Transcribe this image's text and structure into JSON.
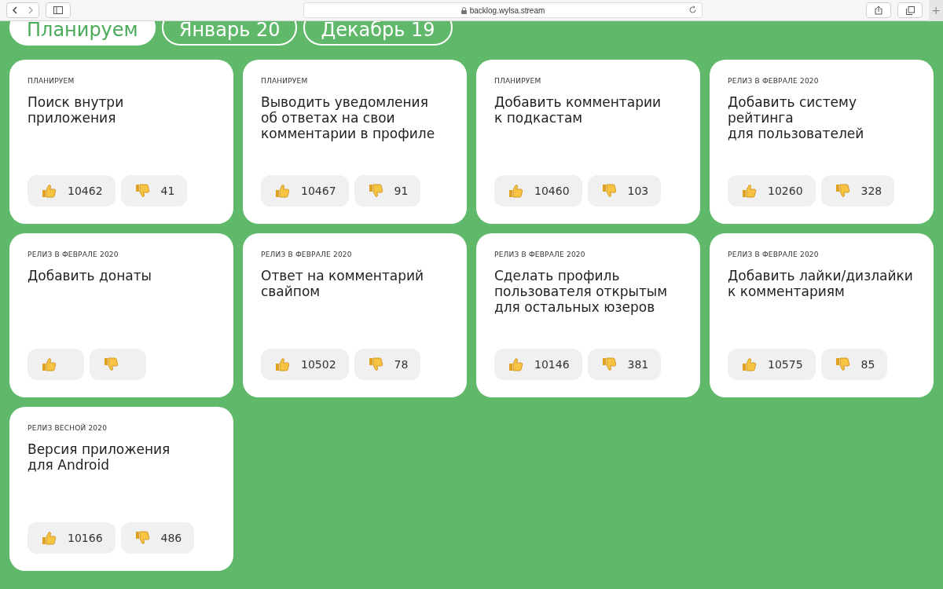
{
  "browser": {
    "url": "backlog.wylsa.stream",
    "new_tab": "+"
  },
  "tabs": [
    {
      "label": "Планируем",
      "selected": true
    },
    {
      "label": "Январь 20",
      "selected": false
    },
    {
      "label": "Декабрь 19",
      "selected": false
    }
  ],
  "cards": [
    {
      "status": "ПЛАНИРУЕМ",
      "title": "Поиск внутри\nприложения",
      "likes": "10462",
      "dislikes": "41"
    },
    {
      "status": "ПЛАНИРУЕМ",
      "title": "Выводить уведомления\nоб ответах на свои\nкомментарии в профиле",
      "likes": "10467",
      "dislikes": "91"
    },
    {
      "status": "ПЛАНИРУЕМ",
      "title": "Добавить комментарии\nк подкастам",
      "likes": "10460",
      "dislikes": "103"
    },
    {
      "status": "РЕЛИЗ В ФЕВРАЛЕ 2020",
      "title": "Добавить систему\nрейтинга\nдля пользователей",
      "likes": "10260",
      "dislikes": "328"
    },
    {
      "status": "РЕЛИЗ В ФЕВРАЛЕ 2020",
      "title": "Добавить донаты"
    },
    {
      "status": "РЕЛИЗ В ФЕВРАЛЕ 2020",
      "title": "Ответ на комментарий\nсвайпом",
      "likes": "10502",
      "dislikes": "78"
    },
    {
      "status": "РЕЛИЗ В ФЕВРАЛЕ 2020",
      "title": "Сделать профиль\nпользователя открытым\nдля остальных юзеров",
      "likes": "10146",
      "dislikes": "381"
    },
    {
      "status": "РЕЛИЗ В ФЕВРАЛЕ 2020",
      "title": "Добавить лайки/дизлайки\nк комментариям",
      "likes": "10575",
      "dislikes": "85"
    },
    {
      "status": "РЕЛИЗ ВЕСНОЙ 2020",
      "title": "Версия приложения\nдля Android",
      "likes": "10166",
      "dislikes": "486"
    }
  ]
}
